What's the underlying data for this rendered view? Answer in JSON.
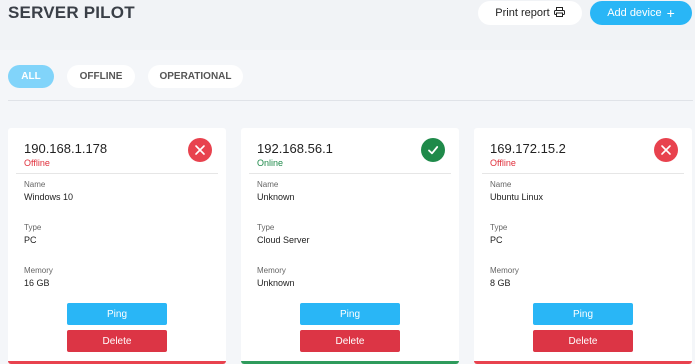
{
  "app": {
    "title": "SERVER PILOT",
    "print_label": "Print report",
    "add_label": "Add device",
    "print_icon": "printer-icon",
    "add_icon": "plus-icon",
    "accent": "#29b6f6",
    "danger": "#dc3545",
    "success": "#1f8a4a"
  },
  "filters": [
    {
      "label": "ALL",
      "active": true
    },
    {
      "label": "OFFLINE",
      "active": false
    },
    {
      "label": "OPERATIONAL",
      "active": false
    }
  ],
  "field_labels": {
    "name": "Name",
    "type": "Type",
    "memory": "Memory"
  },
  "actions": {
    "ping": "Ping",
    "delete": "Delete"
  },
  "devices": [
    {
      "ip": "190.168.1.178",
      "status": "Offline",
      "name": "Windows 10",
      "type": "PC",
      "memory": "16 GB"
    },
    {
      "ip": "192.168.56.1",
      "status": "Online",
      "name": "Unknown",
      "type": "Cloud Server",
      "memory": "Unknown"
    },
    {
      "ip": "169.172.15.2",
      "status": "Offline",
      "name": "Ubuntu Linux",
      "type": "PC",
      "memory": "8 GB"
    }
  ]
}
